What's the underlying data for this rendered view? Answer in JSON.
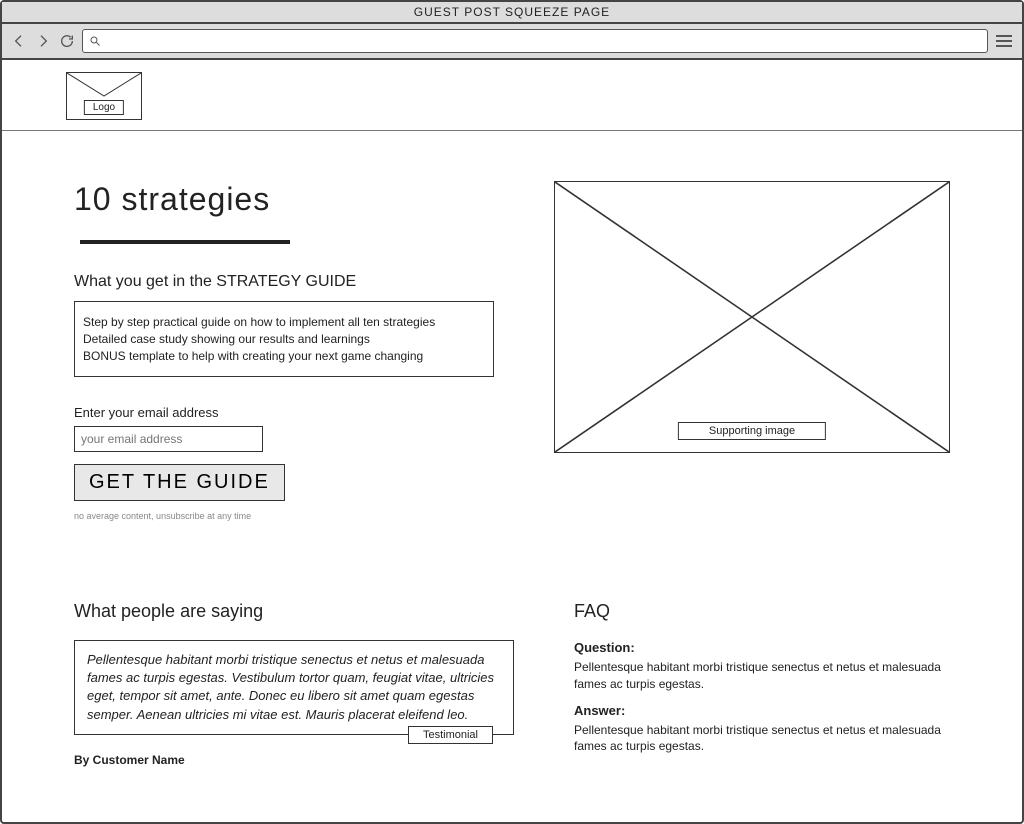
{
  "window": {
    "title": "GUEST POST SQUEEZE PAGE",
    "address": ""
  },
  "logo": {
    "label": "Logo"
  },
  "hero": {
    "headline_prefix": "10 strategies",
    "subheading": "What you get in the STRATEGY GUIDE",
    "bullets": [
      "Step by step practical guide on how to implement all ten strategies",
      "Detailed case study showing our results and learnings",
      "BONUS template to help with creating your next game changing"
    ],
    "email_label": "Enter your email address",
    "email_placeholder": "your email address",
    "cta": "GET THE GUIDE",
    "fineprint": "no average content, unsubscribe at any time",
    "image_caption": "Supporting image"
  },
  "social": {
    "heading": "What people are saying",
    "testimonial": "Pellentesque habitant morbi tristique senectus et netus et malesuada fames ac turpis egestas. Vestibulum tortor quam, feugiat vitae, ultricies eget, tempor sit amet, ante. Donec eu libero sit amet quam egestas semper. Aenean ultricies mi vitae est. Mauris placerat eleifend leo.",
    "tag": "Testimonial",
    "byline": "By Customer Name"
  },
  "faq": {
    "heading": "FAQ",
    "q_label": "Question:",
    "q_text": "Pellentesque habitant morbi tristique senectus et netus et malesuada fames ac turpis egestas.",
    "a_label": "Answer:",
    "a_text": "Pellentesque habitant morbi tristique senectus et netus et malesuada fames ac turpis egestas."
  }
}
